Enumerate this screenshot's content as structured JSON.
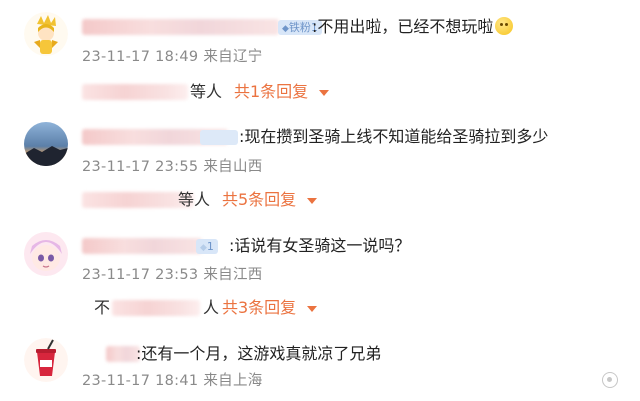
{
  "comments": [
    {
      "badge": "铁粉1",
      "text": ":不用出啦，已经不想玩啦",
      "emoji": "smile-emoji",
      "time": "23-11-17 18:49",
      "location": "来自辽宁",
      "reply_suffix": "等人",
      "reply_link": "共1条回复"
    },
    {
      "text": ":现在攒到圣骑上线不知道能给圣骑拉到多少",
      "time": "23-11-17 23:55",
      "location": "来自山西",
      "reply_suffix": "等人",
      "reply_link": "共5条回复"
    },
    {
      "badge": "1",
      "text": ":话说有女圣骑这一说吗？",
      "time": "23-11-17 23:53",
      "location": "来自江西",
      "reply_prefix": "不",
      "reply_suffix": "人",
      "reply_link": "共3条回复"
    },
    {
      "text": ":还有一个月，这游戏真就凉了兄弟",
      "time": "23-11-17 18:41",
      "location": "来自上海"
    }
  ]
}
